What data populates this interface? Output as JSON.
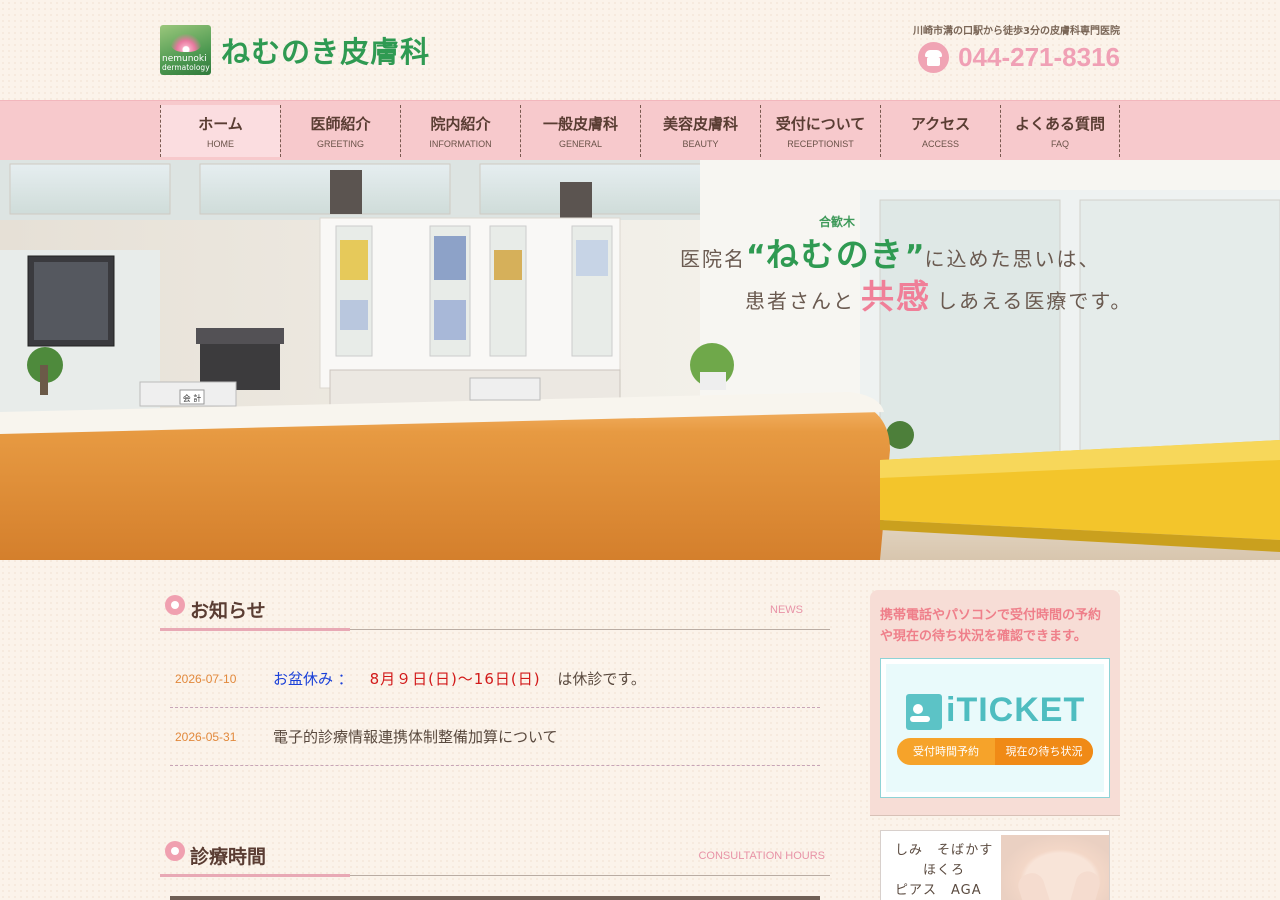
{
  "header": {
    "logo_line1": "nemunoki",
    "logo_line2": "dermatology",
    "logo_text": "ねむのき皮膚科",
    "tagline": "川崎市溝の口駅から徒歩3分の皮膚科専門医院",
    "phone": "044-271-8316"
  },
  "nav": [
    {
      "jp": "ホーム",
      "en": "HOME"
    },
    {
      "jp": "医師紹介",
      "en": "GREETING"
    },
    {
      "jp": "院内紹介",
      "en": "INFORMATION"
    },
    {
      "jp": "一般皮膚科",
      "en": "GENERAL"
    },
    {
      "jp": "美容皮膚科",
      "en": "BEAUTY"
    },
    {
      "jp": "受付について",
      "en": "RECEPTIONIST"
    },
    {
      "jp": "アクセス",
      "en": "ACCESS"
    },
    {
      "jp": "よくある質問",
      "en": "FAQ"
    }
  ],
  "hero": {
    "ruby": "合歓木",
    "prefix": "医院名",
    "quote_open": "“",
    "name": "ねむのき",
    "quote_close": "”",
    "line1_suffix": "に込めた思いは、",
    "line2_prefix": "患者さんと",
    "emphasis": "共感",
    "line2_suffix": "しあえる医療です。",
    "sign_text": "会 計"
  },
  "news": {
    "title": "お知らせ",
    "title_en": "NEWS",
    "items": [
      {
        "date": "2026-07-10",
        "blue": "お盆休み ：",
        "red": "8月９日(日)～16日(日)",
        "text": "は休診です。"
      },
      {
        "date": "2026-05-31",
        "blue": "",
        "red": "",
        "text": "電子的診療情報連携体制整備加算について"
      }
    ]
  },
  "hours": {
    "title": "診療時間",
    "title_en": "CONSULTATION HOURS"
  },
  "sidebar": {
    "note": "携帯電話やパソコンで受付時間の予約や現在の待ち状況を確認できます。",
    "iticket_word": "iTICKET",
    "iticket_btn1": "受付時間予約",
    "iticket_btn2": "現在の待ち状況",
    "beauty_text": "しみ　そばかす\n　　ほくろ\nピアス　AGA"
  },
  "colors": {
    "nav_bg": "#f7c9cc",
    "green": "#2f9a52",
    "pink": "#f07f98",
    "date_orange": "#e2893c"
  }
}
